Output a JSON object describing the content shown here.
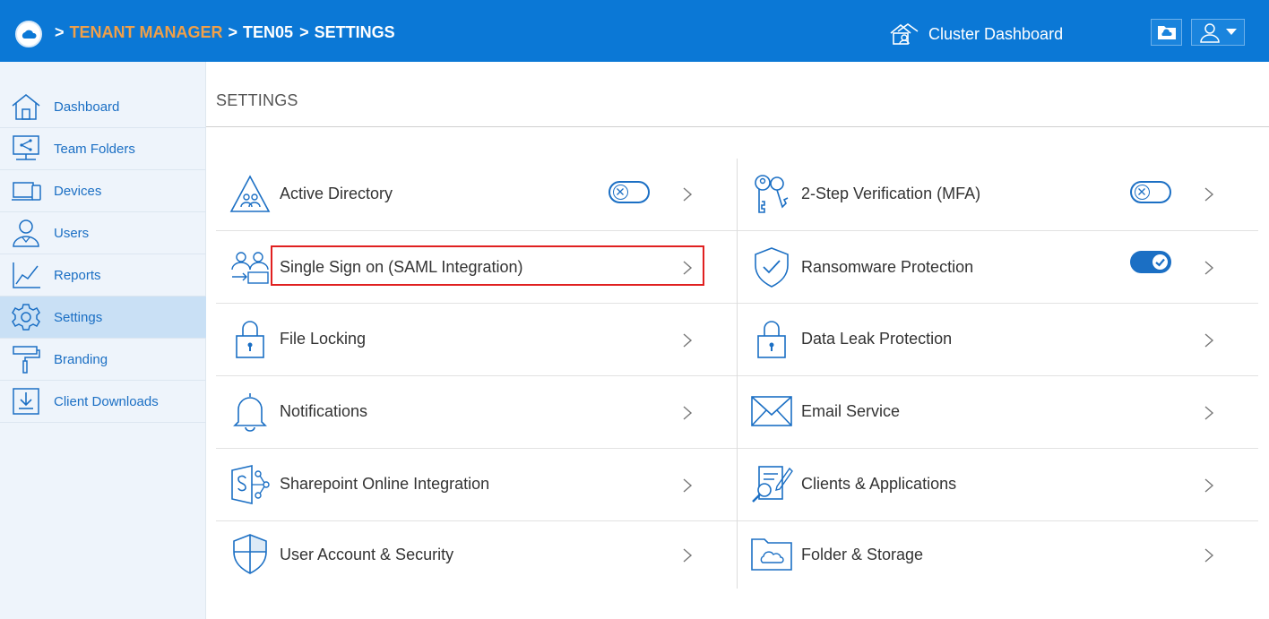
{
  "header": {
    "breadcrumb": {
      "sep1": ">",
      "tenant_manager": "TENANT MANAGER",
      "sep2": ">",
      "tenant": "TEN05",
      "sep3": ">",
      "current": "SETTINGS"
    },
    "cluster_dashboard": "Cluster Dashboard",
    "accent_color": "#f0a049",
    "bar_color": "#0b78d6"
  },
  "sidebar": {
    "items": [
      {
        "label": "Dashboard",
        "icon": "home-icon"
      },
      {
        "label": "Team Folders",
        "icon": "team-folders-icon"
      },
      {
        "label": "Devices",
        "icon": "devices-icon"
      },
      {
        "label": "Users",
        "icon": "users-icon"
      },
      {
        "label": "Reports",
        "icon": "reports-icon"
      },
      {
        "label": "Settings",
        "icon": "gear-icon",
        "active": true
      },
      {
        "label": "Branding",
        "icon": "paint-roller-icon"
      },
      {
        "label": "Client Downloads",
        "icon": "download-icon"
      }
    ]
  },
  "main": {
    "title": "SETTINGS",
    "left": [
      {
        "label": "Active Directory",
        "icon": "active-directory-icon",
        "toggle": "off"
      },
      {
        "label": "Single Sign on (SAML Integration)",
        "icon": "sso-icon",
        "highlighted": true
      },
      {
        "label": "File Locking",
        "icon": "lock-icon"
      },
      {
        "label": "Notifications",
        "icon": "bell-icon"
      },
      {
        "label": "Sharepoint Online Integration",
        "icon": "sharepoint-icon"
      },
      {
        "label": "User Account & Security",
        "icon": "shield-icon"
      }
    ],
    "right": [
      {
        "label": "2-Step Verification (MFA)",
        "icon": "keys-icon",
        "toggle": "off"
      },
      {
        "label": "Ransomware Protection",
        "icon": "shield-check-icon",
        "toggle": "on"
      },
      {
        "label": "Data Leak Protection",
        "icon": "lock-icon"
      },
      {
        "label": "Email Service",
        "icon": "envelope-icon"
      },
      {
        "label": "Clients & Applications",
        "icon": "clients-apps-icon"
      },
      {
        "label": "Folder & Storage",
        "icon": "folder-cloud-icon"
      }
    ]
  }
}
